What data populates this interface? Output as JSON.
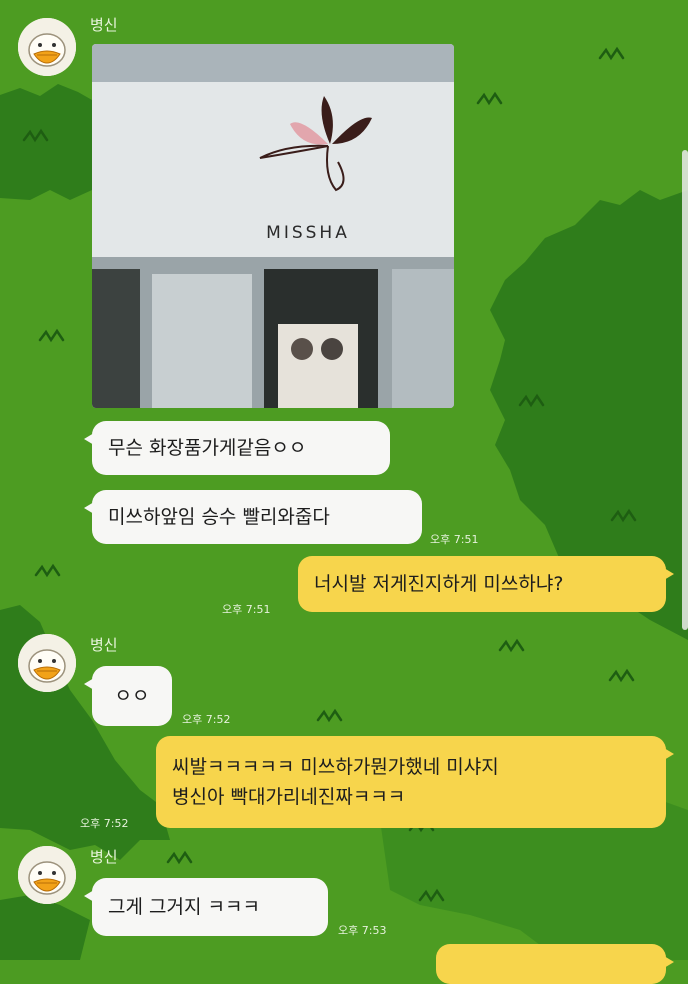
{
  "chat": {
    "sender_name": "병신",
    "photo": {
      "sign_text": "MISSHA"
    },
    "messages": [
      {
        "text": "무슨 화장품가게같음ㅇㅇ"
      },
      {
        "text": "미쓰하앞임 승수 빨리와줍다"
      },
      {
        "time": "오후 7:51"
      },
      {
        "text": "너시발 저게진지하게 미쓰하냐?"
      },
      {
        "time": "오후 7:51"
      },
      {
        "text": "ㅇㅇ"
      },
      {
        "time": "오후 7:52"
      },
      {
        "text_line1": "씨발ㅋㅋㅋㅋㅋ 미쓰하가뭔가했네 미샤지",
        "text_line2": "병신아 빡대가리네진짜ㅋㅋㅋ"
      },
      {
        "time": "오후 7:52"
      },
      {
        "text": "그게 그거지 ㅋㅋㅋ"
      },
      {
        "time": "오후 7:53"
      }
    ]
  },
  "colors": {
    "background": "#4c9b22",
    "bush": "#2f7d1b",
    "incoming_bubble": "#f7f7f5",
    "outgoing_bubble": "#f7d54c"
  },
  "icons": {
    "avatar": "bird-avatar-icon"
  }
}
